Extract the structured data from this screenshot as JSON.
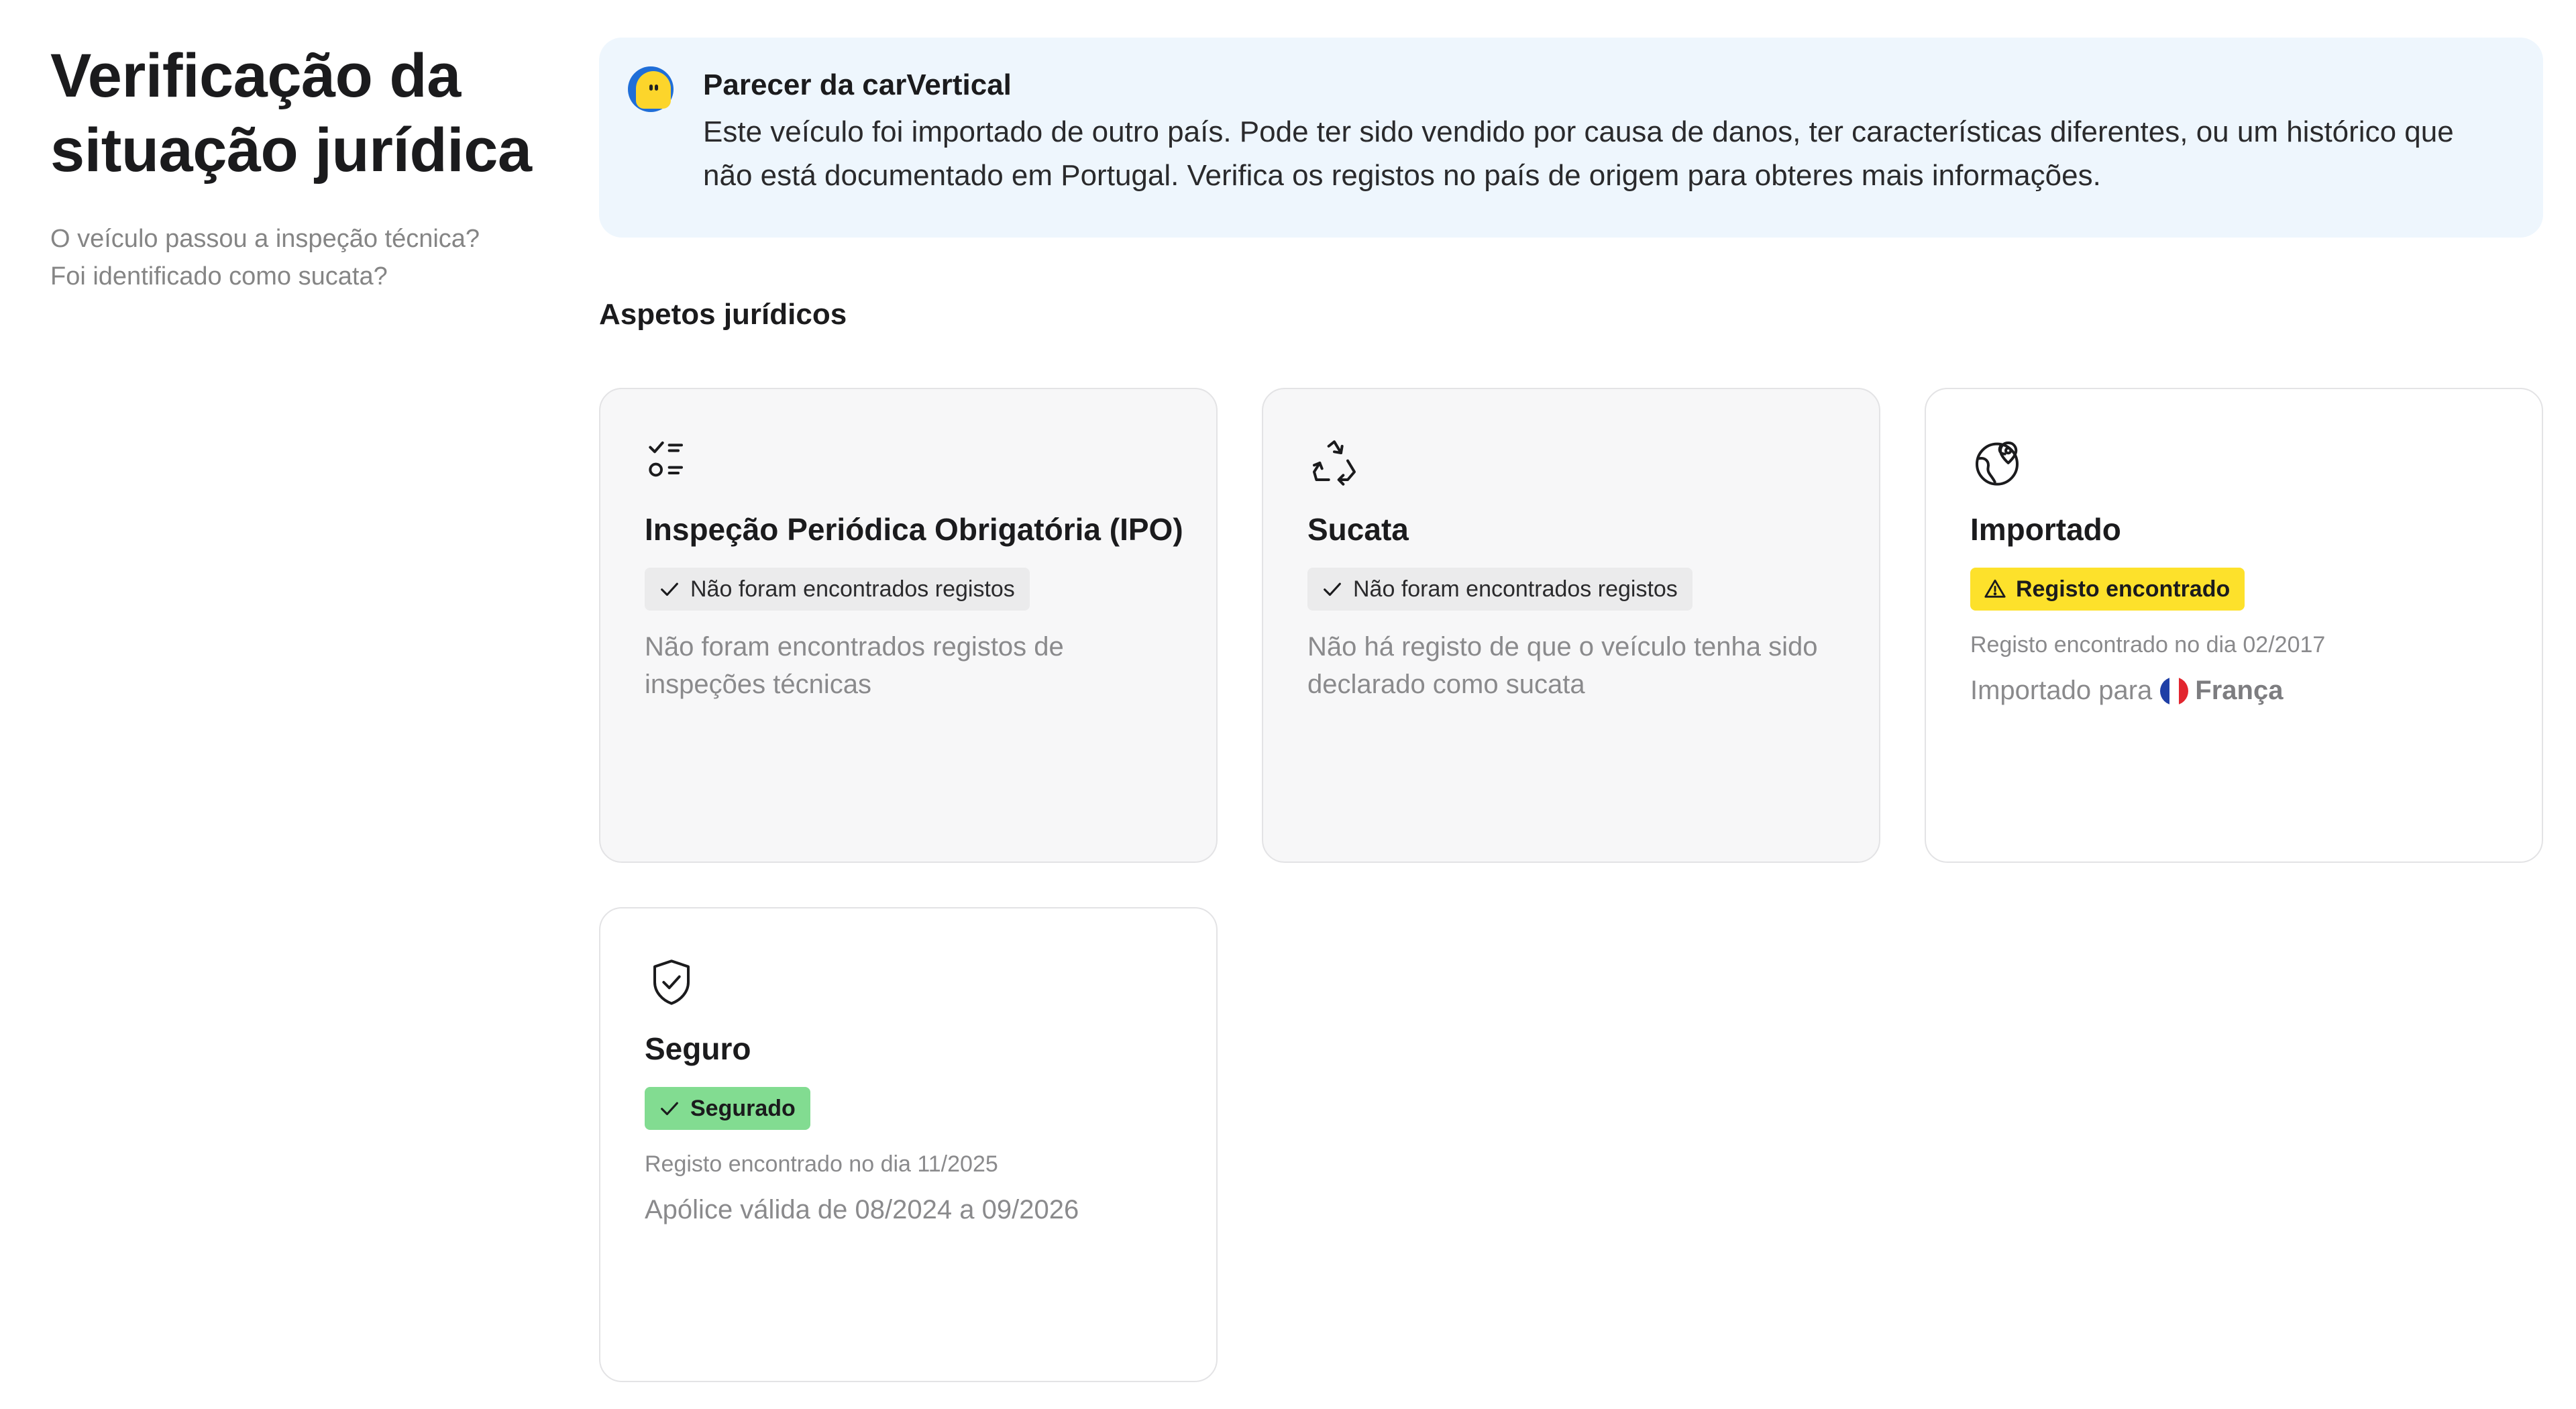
{
  "page": {
    "title": "Verificação da situação jurídica",
    "subtitle_lines": [
      "O veículo passou a inspeção técnica?",
      "Foi identificado como sucata?"
    ]
  },
  "notice": {
    "title": "Parecer da carVertical",
    "text": "Este veículo foi importado de outro país. Pode ter sido vendido por causa de danos, ter características diferentes, ou um histórico que não está documentado em Portugal. Verifica os registos no país de origem para obteres mais informações.",
    "logo_icon": "carvertical-logo-icon"
  },
  "section": {
    "title": "Aspetos jurídicos"
  },
  "cards": [
    {
      "icon": "checklist-icon",
      "title": "Inspeção Periódica Obrigatória (IPO)",
      "badge": {
        "label": "Não foram encontrados registos",
        "variant": "neutral",
        "icon": "check-icon"
      },
      "description": "Não foram encontrados registos de inspeções técnicas"
    },
    {
      "icon": "recycle-icon",
      "title": "Sucata",
      "badge": {
        "label": "Não foram encontrados registos",
        "variant": "neutral",
        "icon": "check-icon"
      },
      "description": "Não há registo de que o veículo tenha sido declarado como sucata"
    },
    {
      "icon": "globe-pin-icon",
      "title": "Importado",
      "badge": {
        "label": "Registo encontrado",
        "variant": "warning",
        "icon": "warning-icon"
      },
      "date": "Registo encontrado no dia 02/2017",
      "detail_prefix": "Importado para",
      "country": "França",
      "flag_icon": "france-flag-icon"
    },
    {
      "icon": "shield-check-icon",
      "title": "Seguro",
      "badge": {
        "label": "Segurado",
        "variant": "success",
        "icon": "check-icon"
      },
      "date": "Registo encontrado no dia 11/2025",
      "detail": "Apólice válida de 08/2024 a 09/2026"
    }
  ],
  "colors": {
    "notice_bg": "#eef6fd",
    "warning_badge": "#fde12b",
    "success_badge": "#82dc91",
    "neutral_badge": "#ebebec",
    "muted_card": "#f7f7f8"
  }
}
